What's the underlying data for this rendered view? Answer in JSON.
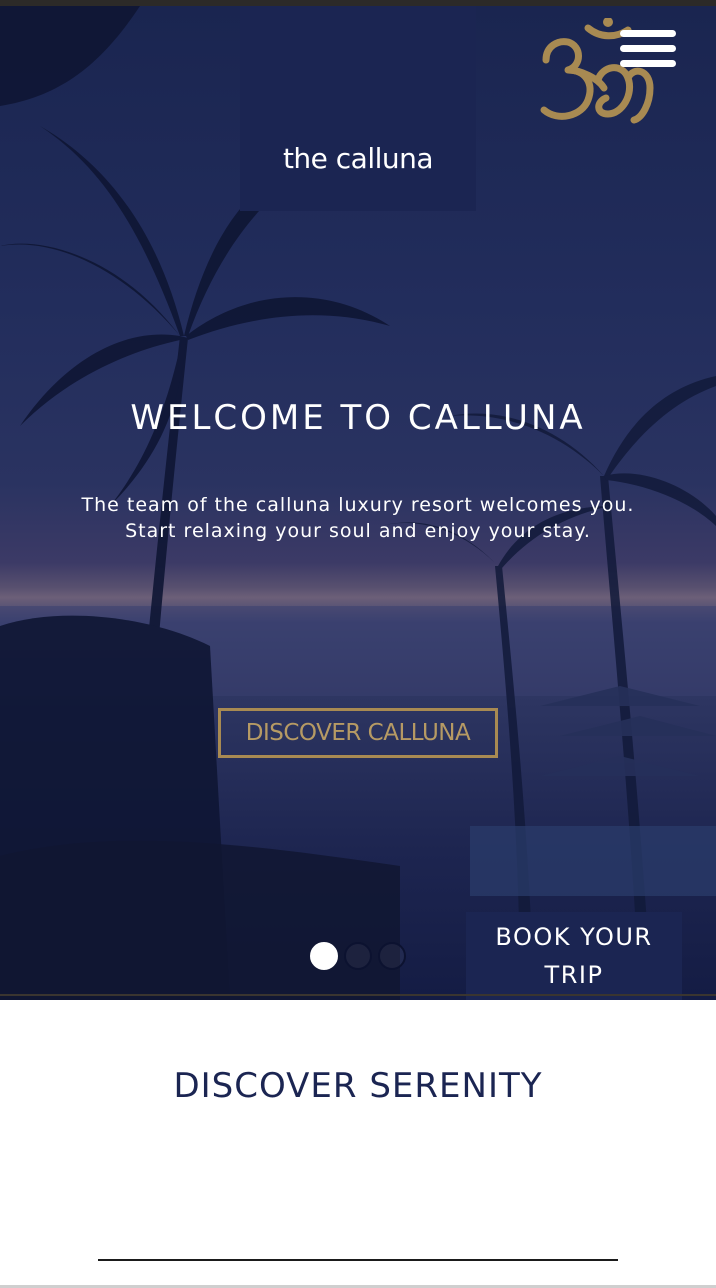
{
  "brand": {
    "name": "the calluna",
    "logo_icon": "om-icon",
    "logo_color": "#a88a52",
    "box_color": "#1b2552"
  },
  "menu": {
    "icon": "hamburger-menu-icon"
  },
  "hero": {
    "title": "WELCOME TO CALLUNA",
    "subtitle_line1": "The team of the calluna luxury resort welcomes you.",
    "subtitle_line2": "Start relaxing your soul and enjoy your stay.",
    "cta_label": "DISCOVER CALLUNA",
    "background": "tropical beach at dusk with palm trees and pool umbrellas"
  },
  "carousel": {
    "slide_count": 3,
    "active_index": 0
  },
  "booking": {
    "line1": "BOOK YOUR",
    "line2": "TRIP"
  },
  "section": {
    "title": "DISCOVER SERENITY"
  },
  "colors": {
    "navy": "#1b2552",
    "gold": "#a88a52",
    "white": "#ffffff"
  }
}
